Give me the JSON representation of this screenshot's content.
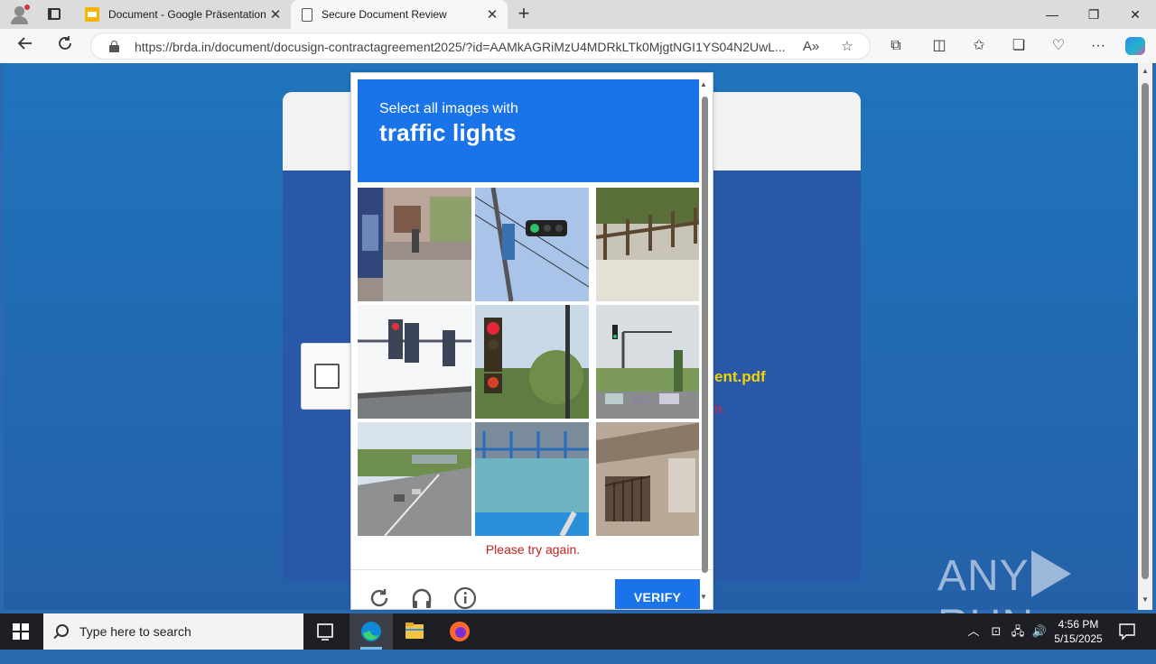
{
  "browser": {
    "tabs": [
      {
        "title": "Document - Google Präsentation",
        "active": false
      },
      {
        "title": "Secure Document Review",
        "active": true
      }
    ],
    "tab_close_glyph": "✕",
    "new_tab_glyph": "+",
    "url": "https://brda.in/document/docusign-contractagreement2025/?id=AAMkAGRiMzU4MDRkLTk0MjgtNGI1YS04N2UwL...",
    "window_controls": {
      "minimize": "—",
      "restore": "❐",
      "close": "✕"
    }
  },
  "page": {
    "filename_fragment": "ent.pdf",
    "red_text_fragment": "n."
  },
  "captcha": {
    "prompt": "Select all images with",
    "target": "traffic lights",
    "error": "Please try again.",
    "verify_label": "VERIFY",
    "tiles": [
      {
        "id": 1,
        "subject": "street-bus"
      },
      {
        "id": 2,
        "subject": "traffic-light-wires"
      },
      {
        "id": 3,
        "subject": "wooden-fence"
      },
      {
        "id": 4,
        "subject": "traffic-lights-roof"
      },
      {
        "id": 5,
        "subject": "red-traffic-light"
      },
      {
        "id": 6,
        "subject": "street-traffic-light"
      },
      {
        "id": 7,
        "subject": "highway"
      },
      {
        "id": 8,
        "subject": "pool-railing"
      },
      {
        "id": 9,
        "subject": "building-balcony"
      }
    ]
  },
  "watermark": {
    "left": "ANY",
    "right": "RUN"
  },
  "taskbar": {
    "search_placeholder": "Type here to search",
    "time": "4:56 PM",
    "date": "5/15/2025"
  },
  "colors": {
    "captcha_blue": "#1a73e8",
    "page_blue": "#2460a8",
    "error_red": "#c5221f",
    "filename_yellow": "#f2d500"
  }
}
